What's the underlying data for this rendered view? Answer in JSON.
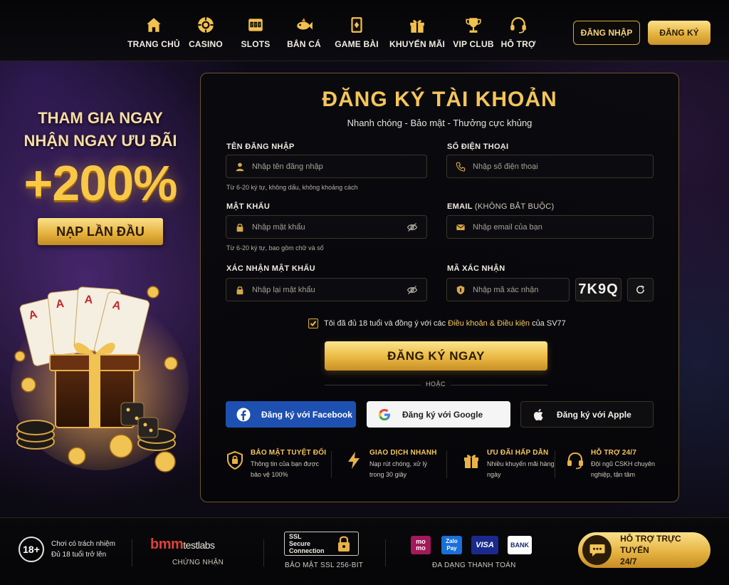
{
  "nav": {
    "items": [
      {
        "label": "TRANG CHỦ",
        "icon": "home-icon"
      },
      {
        "label": "CASINO",
        "icon": "casino-chip-icon"
      },
      {
        "label": "SLOTS",
        "icon": "slot-machine-icon"
      },
      {
        "label": "BẮN CÁ",
        "icon": "fish-icon"
      },
      {
        "label": "GAME BÀI",
        "icon": "card-icon"
      },
      {
        "label": "KHUYẾN MÃI",
        "icon": "gift-icon"
      },
      {
        "label": "VIP CLUB",
        "icon": "trophy-icon"
      },
      {
        "label": "HỖ TRỢ",
        "icon": "headset-icon"
      }
    ],
    "login_label": "ĐĂNG NHẬP",
    "register_label": "ĐĂNG KÝ"
  },
  "promo": {
    "line1": "THAM GIA NGAY",
    "line2": "NHẬN NGAY ƯU ĐÃI",
    "bonus": "+200%",
    "ribbon": "NẠP LẦN ĐẦU"
  },
  "form": {
    "title": "ĐĂNG KÝ TÀI KHOẢN",
    "subtitle": "Nhanh chóng - Bảo mật - Thưởng cực khủng",
    "username": {
      "label": "TÊN ĐĂNG NHẬP",
      "placeholder": "Nhập tên đăng nhập",
      "hint": "Từ 6-20 ký tự, không dấu, không khoảng cách"
    },
    "phone": {
      "label": "SỐ ĐIỆN THOẠI",
      "placeholder": "Nhập số điện thoại"
    },
    "password": {
      "label": "MẬT KHẨU",
      "placeholder": "Nhập mật khẩu",
      "hint": "Từ 6-20 ký tự, bao gồm chữ và số"
    },
    "email": {
      "label": "EMAIL",
      "label_optional": "(KHÔNG BẮT BUỘC)",
      "placeholder": "Nhập email của bạn"
    },
    "confirm": {
      "label": "XÁC NHẬN MẬT KHẨU",
      "placeholder": "Nhập lại mật khẩu"
    },
    "captcha": {
      "label": "MÃ XÁC NHẬN",
      "placeholder": "Nhập mã xác nhận",
      "code": "7K9Q"
    },
    "terms": {
      "prefix": "Tôi đã đủ 18 tuổi và đồng ý với các",
      "link": "Điều khoản & Điều kiện",
      "suffix": "của SV77",
      "checked": true
    },
    "submit_label": "ĐĂNG KÝ NGAY",
    "or_label": "HOẶC",
    "social": {
      "facebook": "Đăng ký với Facebook",
      "google": "Đăng ký với Google",
      "apple": "Đăng ký với Apple"
    }
  },
  "features": [
    {
      "title": "BẢO MẬT TUYỆT ĐỐI",
      "desc": "Thông tin của bạn được bảo vệ 100%",
      "icon": "shield-lock-icon"
    },
    {
      "title": "GIAO DỊCH NHANH",
      "desc": "Nạp rút chóng, xử lý trong 30 giây",
      "icon": "lightning-icon"
    },
    {
      "title": "ƯU ĐÃI HẤP DẪN",
      "desc": "Nhiều khuyến mãi hàng ngày",
      "icon": "gift-icon"
    },
    {
      "title": "HỖ TRỢ 24/7",
      "desc": "Đội ngũ CSKH chuyên nghiệp, tận tâm",
      "icon": "headset-icon"
    }
  ],
  "footer": {
    "age_badge": "18+",
    "age_line1": "Chơi có trách nhiệm",
    "age_line2": "Đủ 18 tuổi trở lên",
    "bmm_brand": "bmm",
    "bmm_suffix": "testlabs",
    "bmm_caption": "CHỨNG NHẬN",
    "ssl_text1": "SSL",
    "ssl_text2": "Secure",
    "ssl_text3": "Connection",
    "ssl_caption": "BẢO MẬT SSL 256-BIT",
    "payments": [
      {
        "label": "mo\nmo",
        "color": "#a3195b"
      },
      {
        "label": "Zalo Pay",
        "color": "#1a6fd8"
      },
      {
        "label": "VISA",
        "color": "#1a2a8c"
      },
      {
        "label": "BANK",
        "color": "#ffffff"
      }
    ],
    "pay_caption": "ĐA DẠNG THANH TOÁN",
    "support_line1": "HỖ TRỢ TRỰC TUYẾN",
    "support_line2": "24/7"
  },
  "colors": {
    "gold": "#f4c55a",
    "accent_bg": "#07070c",
    "facebook": "#1d50b0"
  }
}
